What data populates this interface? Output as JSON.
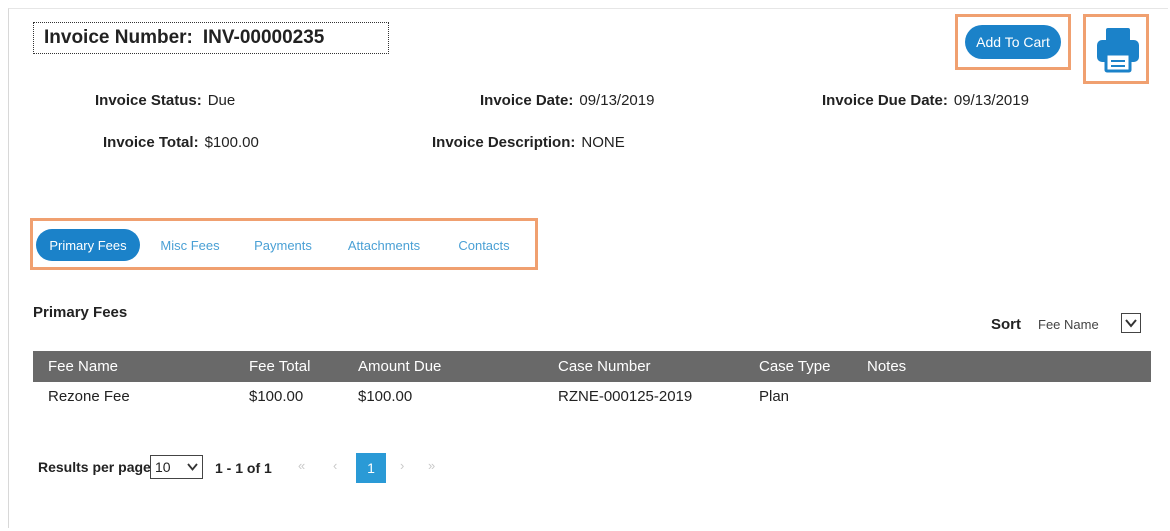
{
  "header": {
    "invoice_number_label": "Invoice Number:",
    "invoice_number_value": "INV-00000235",
    "add_to_cart_label": "Add To Cart"
  },
  "invoice": {
    "status_label": "Invoice Status:",
    "status_value": "Due",
    "date_label": "Invoice Date:",
    "date_value": "09/13/2019",
    "due_date_label": "Invoice Due Date:",
    "due_date_value": "09/13/2019",
    "total_label": "Invoice Total:",
    "total_value": "$100.00",
    "description_label": "Invoice Description:",
    "description_value": "NONE"
  },
  "tabs": [
    {
      "label": "Primary Fees",
      "active": true
    },
    {
      "label": "Misc Fees",
      "active": false
    },
    {
      "label": "Payments",
      "active": false
    },
    {
      "label": "Attachments",
      "active": false
    },
    {
      "label": "Contacts",
      "active": false
    }
  ],
  "section": {
    "title": "Primary Fees",
    "sort_label": "Sort",
    "sort_value": "Fee Name"
  },
  "table": {
    "columns": [
      "Fee Name",
      "Fee Total",
      "Amount Due",
      "Case Number",
      "Case Type",
      "Notes"
    ],
    "rows": [
      [
        "Rezone Fee",
        "$100.00",
        "$100.00",
        "RZNE-000125-2019",
        "Plan",
        ""
      ]
    ]
  },
  "pagination": {
    "results_label": "Results per page",
    "per_page_value": "10",
    "range_text": "1 - 1 of 1",
    "first_glyph": "«",
    "prev_glyph": "‹",
    "next_glyph": "›",
    "last_glyph": "»",
    "current_page": "1"
  },
  "colors": {
    "accent": "#1b82c9",
    "highlight": "#f0a070",
    "table_header": "#696969",
    "tab_text": "#4aa0d5"
  },
  "icons": {
    "print": "printer-icon",
    "dropdown": "chevron-down-icon"
  }
}
